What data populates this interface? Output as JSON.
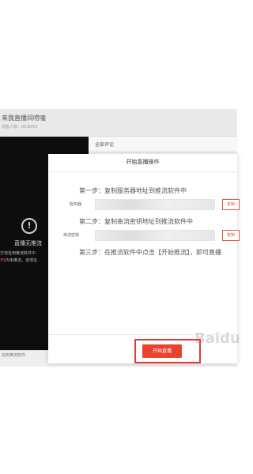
{
  "background_page": {
    "title": "来我直播间唠嗑",
    "subtitle": "观看人数：00/8002",
    "comments_tab": "全部评论",
    "video_error": {
      "icon": "exclamation-icon",
      "title": "直播无推流",
      "line1": "方地址到推流软件中",
      "line2_highlight": "开",
      "line2_rest": "(内未推流，该地址"
    },
    "bottom_text": "址到推流软件"
  },
  "modal": {
    "title": "开始直播操作",
    "step1": "第一步：复制服务器地址到推流软件中",
    "server_label": "服务器",
    "copy_label": "复制",
    "step2": "第二步：复制串流密钥地址到推流软件中",
    "key_label": "串流密钥",
    "step3": "第三步：在推流软件中点击【开始推流】，即可直播",
    "start_button": "开始直播",
    "watermark": "Baidu"
  },
  "colors": {
    "accent": "#e8432f",
    "highlight_border": "#e53b31",
    "video_bg": "#0d0d0d"
  }
}
